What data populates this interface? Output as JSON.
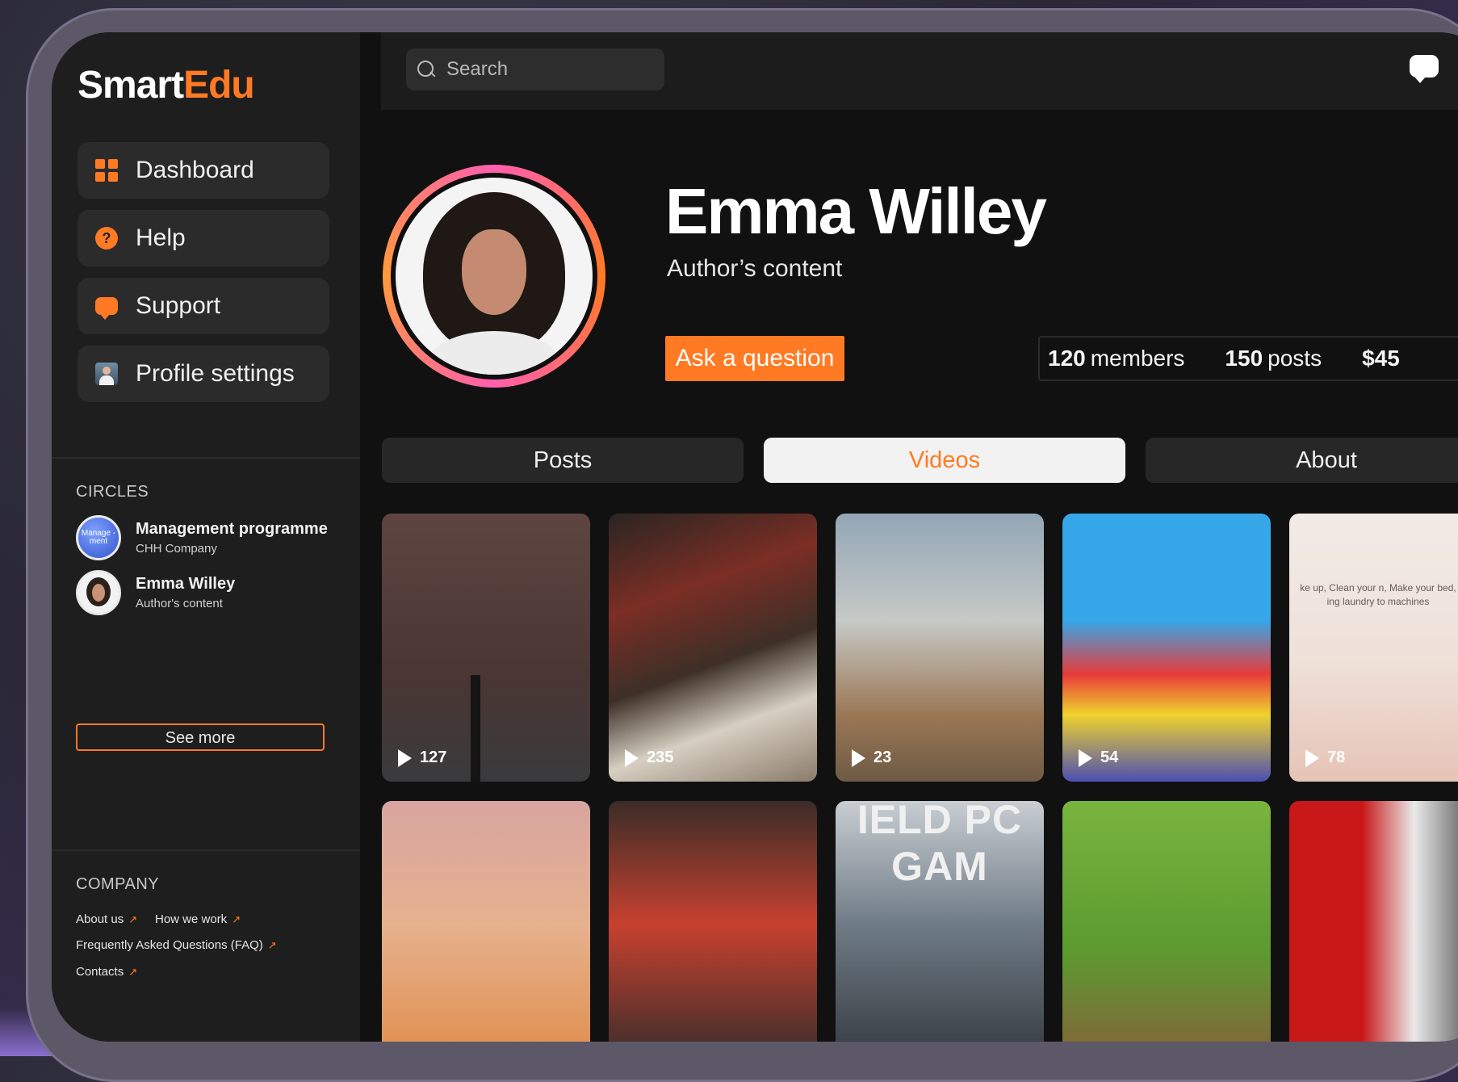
{
  "app": {
    "logo_main": "Smart",
    "logo_accent": "Edu"
  },
  "nav": [
    {
      "label": "Dashboard",
      "icon": "grid-icon"
    },
    {
      "label": "Help",
      "icon": "help-icon"
    },
    {
      "label": "Support",
      "icon": "chat-icon"
    },
    {
      "label": "Profile settings",
      "icon": "avatar-icon"
    }
  ],
  "circles": {
    "title": "CIRCLES",
    "items": [
      {
        "name": "Management programme",
        "sub": "CHH Company",
        "avatar_text": "Manage -ment"
      },
      {
        "name": "Emma Willey",
        "sub": "Author's content"
      }
    ],
    "see_more": "See more"
  },
  "company": {
    "title": "COMPANY",
    "links": [
      "About us",
      "How we work",
      "Frequently Asked Questions (FAQ)",
      "Contacts"
    ]
  },
  "search": {
    "placeholder": "Search"
  },
  "profile": {
    "name": "Emma Willey",
    "subtitle": "Author’s content",
    "ask_button": "Ask a question",
    "stats": [
      {
        "value": "120",
        "label": "members"
      },
      {
        "value": "150",
        "label": "posts"
      },
      {
        "value": "$45",
        "label": ""
      }
    ]
  },
  "tabs": [
    {
      "label": "Posts",
      "active": false
    },
    {
      "label": "Videos",
      "active": true
    },
    {
      "label": "About",
      "active": false
    }
  ],
  "videos": [
    {
      "count": "127"
    },
    {
      "count": "235"
    },
    {
      "count": "23"
    },
    {
      "count": "54"
    },
    {
      "count": "78",
      "overlay_text": "ke up, Clean your n, Make your bed, ing laundry to machines"
    },
    {},
    {},
    {
      "overlay_text": "IELD PC GAM"
    },
    {},
    {}
  ],
  "colors": {
    "accent": "#ff7a22",
    "background": "#111111",
    "sidebar": "#1e1e1f"
  }
}
